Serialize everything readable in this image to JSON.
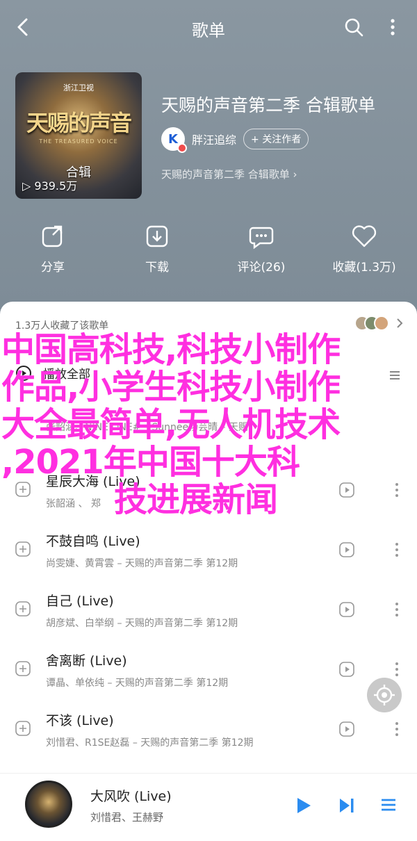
{
  "topbar": {
    "title": "歌单"
  },
  "album": {
    "cover_brand": "浙江卫视",
    "cover_show_title": "天赐的声音",
    "cover_show_subtitle": "THE TREASURED VOICE",
    "cover_label": "合辑",
    "plays": "939.5万",
    "title": "天赐的声音第二季 合辑歌单",
    "creator_name": "胖汪追综",
    "follow_label": "+ 关注作者",
    "description": "天赐的声音第二季 合辑歌单 ›"
  },
  "actions": [
    {
      "label": "分享",
      "icon": "share-icon"
    },
    {
      "label": "下载",
      "icon": "download-icon"
    },
    {
      "label": "评论(26)",
      "icon": "comment-icon"
    },
    {
      "label": "收藏(1.3万)",
      "icon": "heart-icon"
    }
  ],
  "sheet": {
    "collected_text": "1.3万人收藏了该歌单",
    "playall_label": "播放全部",
    "songs": [
      {
        "title": "星辰大海 (Live)",
        "sub": "张韶涵 、 郑"
      },
      {
        "title": "不鼓自鸣 (Live)",
        "sub": "尚雯婕、黄霄雲 – 天赐的声音第二季 第12期"
      },
      {
        "title": "自己 (Live)",
        "sub": "胡彦斌、白举纲 – 天赐的声音第二季 第12期"
      },
      {
        "title": "舍离断 (Live)",
        "sub": "谭晶、单依纯 – 天赐的声音第二季 第12期"
      },
      {
        "title": "不该 (Live)",
        "sub": "刘惜君、R1SE赵磊 – 天赐的声音第二季 第12期"
      }
    ],
    "hidden_row_sub": "张韶涵、NINE ONE# – Sunnee杨芸晴 – 天赐"
  },
  "player": {
    "title": "大风吹 (Live)",
    "artist": "刘惜君、王赫野"
  },
  "overlay": {
    "line1": "中国高科技,科技小制作",
    "line2": "作品,小学生科技小制作",
    "line3": "大全最简单,无人机技术",
    "line4": ",2021年中国十大科",
    "line5": "技进展新闻"
  },
  "colors": {
    "overlay": "#ff2fe0",
    "header_bg": "#7f8d98",
    "accent_blue": "#1f5fd6"
  }
}
